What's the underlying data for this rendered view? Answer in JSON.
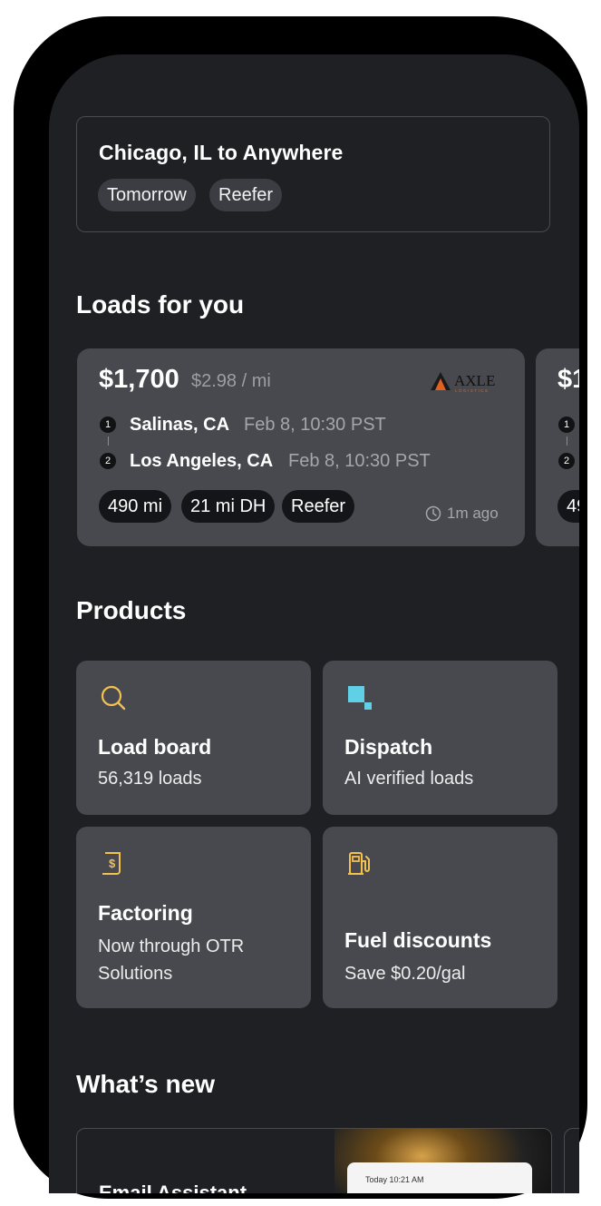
{
  "search": {
    "title": "Chicago, IL to Anywhere",
    "chips": [
      "Tomorrow",
      "Reefer"
    ]
  },
  "loads_section": {
    "title": "Loads for you"
  },
  "load_card": {
    "price": "$1,700",
    "rate": "$2.98 / mi",
    "broker_logo_text": "AXLE",
    "broker_logo_sub": "LOGISTICS",
    "stops": [
      {
        "num": "1",
        "city": "Salinas, CA",
        "time": "Feb 8, 10:30 PST"
      },
      {
        "num": "2",
        "city": "Los Angeles, CA",
        "time": "Feb 8, 10:30 PST"
      }
    ],
    "chips": [
      "490 mi",
      "21 mi DH",
      "Reefer"
    ],
    "posted": "1m ago",
    "icons": {
      "posted": "clock-icon"
    }
  },
  "load_card_peek": {
    "price": "$1",
    "stops": [
      "1",
      "2"
    ],
    "chip": "49"
  },
  "products_section": {
    "title": "Products"
  },
  "products": [
    {
      "title": "Load board",
      "sub": "56,319 loads",
      "icon": "search-icon",
      "color": "#f2c14e"
    },
    {
      "title": "Dispatch",
      "sub": "AI verified loads",
      "icon": "dispatch-icon",
      "color": "#5fd0e6"
    },
    {
      "title": "Factoring",
      "sub": "Now through OTR Solutions",
      "sub_line1": "Now through OTR",
      "sub_line2": "Solutions",
      "icon": "invoice-dollar-icon",
      "color": "#f2c14e"
    },
    {
      "title": "Fuel discounts",
      "sub": "Save $0.20/gal",
      "icon": "fuel-pump-icon",
      "color": "#f2c14e"
    }
  ],
  "news_section": {
    "title": "What’s new"
  },
  "news": {
    "title": "Email Assistant",
    "notif_time": "Today 10:21 AM"
  }
}
